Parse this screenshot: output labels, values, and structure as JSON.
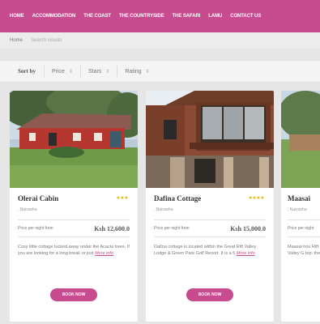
{
  "nav": {
    "items": [
      "HOME",
      "ACCOMMODATION",
      "THE COAST",
      "THE COUNTRYSIDE",
      "THE SAFARI",
      "LAMU",
      "CONTACT US"
    ]
  },
  "breadcrumb": {
    "home": "Home",
    "current": "Search results"
  },
  "sort": {
    "label": "Sort by",
    "options": [
      "Price",
      "Stars",
      "Rating"
    ]
  },
  "listings": [
    {
      "title": "Olerai Cabin",
      "stars": "★★★",
      "location": ", Naivasha",
      "price_label": "Price per night from",
      "price": "Ksh 12,600.0",
      "description": "Cosy little cottage tucked away under the Acacia trees. If you are looking for a long break or just ",
      "more": "More info",
      "button": "BOOK NOW"
    },
    {
      "title": "Dafina Cottage",
      "stars": "★★★★",
      "location": ", Naivasha",
      "price_label": "Price per night from",
      "price": "Ksh 15,000.0",
      "description": "Dafina cottage is located within the Great Rift Valley Lodge & Green Park Golf Resort. It is a 5 ",
      "more": "More info",
      "button": "BOOK NOW"
    },
    {
      "title": "Maasai",
      "location": ", Naivasha",
      "price_label": "Price per night",
      "description": "Maasai hou Rift Valley G top, the vie"
    }
  ],
  "colors": {
    "accent": "#c94b8f",
    "star": "#e6b400"
  }
}
